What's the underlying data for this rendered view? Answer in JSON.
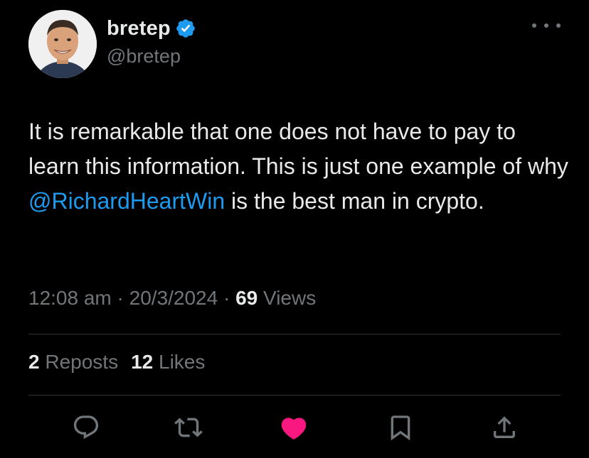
{
  "author": {
    "display_name": "bretep",
    "handle": "@bretep",
    "verified_icon": "verified-badge-icon"
  },
  "tweet": {
    "text_before": "It is remarkable that one does not have to pay to learn this information. This is just one example of why ",
    "mention": "@RichardHeartWin",
    "text_after": " is the best man in crypto."
  },
  "meta": {
    "time": "12:08 am",
    "sep1": " · ",
    "date": "20/3/2024",
    "sep2": " · ",
    "views_count": "69",
    "views_label": " Views"
  },
  "stats": {
    "reposts_count": "2",
    "reposts_label": " Reposts",
    "likes_count": "12",
    "likes_label": " Likes"
  },
  "actions": [
    "reply-icon",
    "repost-icon",
    "like-icon",
    "bookmark-icon",
    "share-icon"
  ],
  "colors": {
    "background": "#000000",
    "text": "#e7e9ea",
    "secondary": "#71767b",
    "mention": "#1d9bf0",
    "like": "#f91880",
    "divider": "#2f3336"
  }
}
